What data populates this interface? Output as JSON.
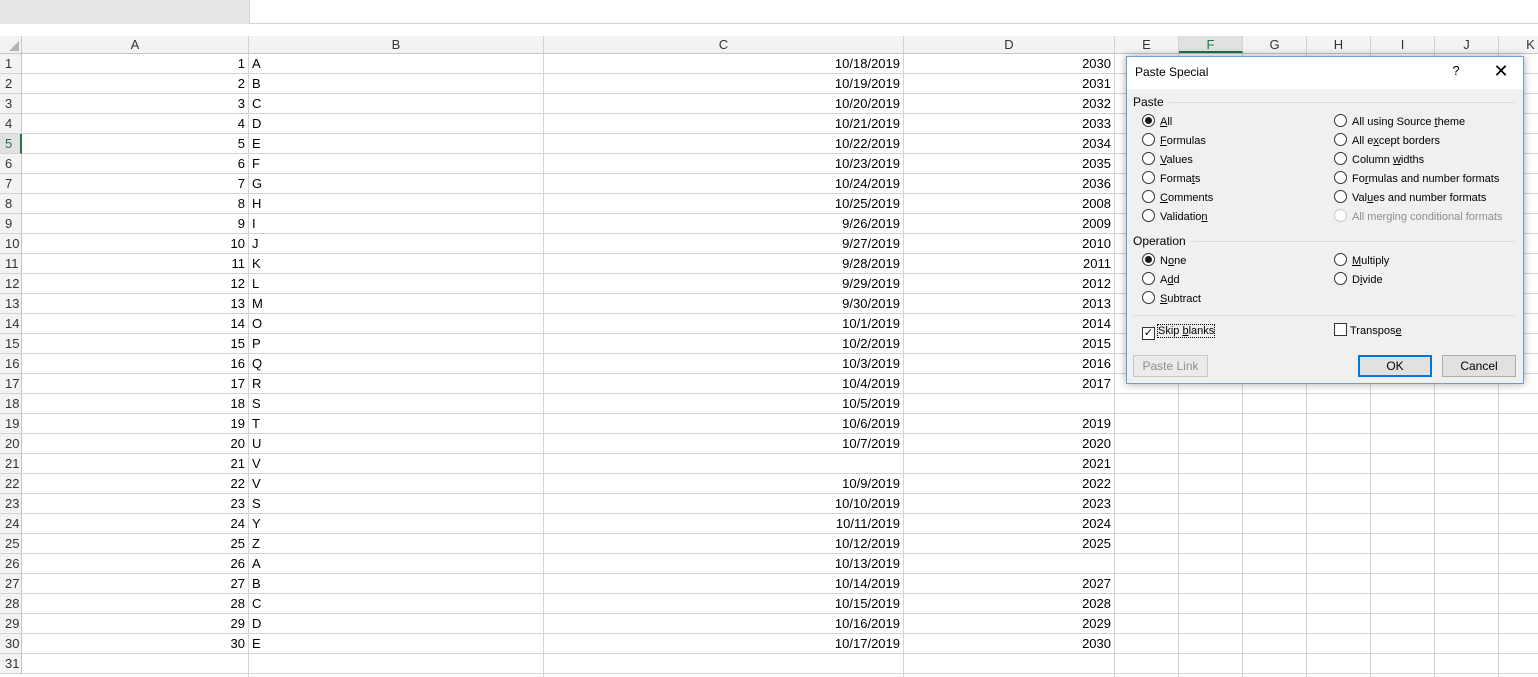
{
  "columns": [
    "A",
    "B",
    "C",
    "D",
    "E",
    "F",
    "G",
    "H",
    "I",
    "J",
    "K"
  ],
  "selected_column": "F",
  "selected_row": "5",
  "rows": [
    {
      "n": "1",
      "a": "1",
      "b": "A",
      "c": "10/18/2019",
      "d": "2030"
    },
    {
      "n": "2",
      "a": "2",
      "b": "B",
      "c": "10/19/2019",
      "d": "2031"
    },
    {
      "n": "3",
      "a": "3",
      "b": "C",
      "c": "10/20/2019",
      "d": "2032"
    },
    {
      "n": "4",
      "a": "4",
      "b": "D",
      "c": "10/21/2019",
      "d": "2033"
    },
    {
      "n": "5",
      "a": "5",
      "b": "E",
      "c": "10/22/2019",
      "d": "2034"
    },
    {
      "n": "6",
      "a": "6",
      "b": "F",
      "c": "10/23/2019",
      "d": "2035"
    },
    {
      "n": "7",
      "a": "7",
      "b": "G",
      "c": "10/24/2019",
      "d": "2036"
    },
    {
      "n": "8",
      "a": "8",
      "b": "H",
      "c": "10/25/2019",
      "d": "2008"
    },
    {
      "n": "9",
      "a": "9",
      "b": "I",
      "c": "9/26/2019",
      "d": "2009"
    },
    {
      "n": "10",
      "a": "10",
      "b": "J",
      "c": "9/27/2019",
      "d": "2010"
    },
    {
      "n": "11",
      "a": "11",
      "b": "K",
      "c": "9/28/2019",
      "d": "2011"
    },
    {
      "n": "12",
      "a": "12",
      "b": "L",
      "c": "9/29/2019",
      "d": "2012"
    },
    {
      "n": "13",
      "a": "13",
      "b": "M",
      "c": "9/30/2019",
      "d": "2013"
    },
    {
      "n": "14",
      "a": "14",
      "b": "O",
      "c": "10/1/2019",
      "d": "2014"
    },
    {
      "n": "15",
      "a": "15",
      "b": "P",
      "c": "10/2/2019",
      "d": "2015"
    },
    {
      "n": "16",
      "a": "16",
      "b": "Q",
      "c": "10/3/2019",
      "d": "2016"
    },
    {
      "n": "17",
      "a": "17",
      "b": "R",
      "c": "10/4/2019",
      "d": "2017"
    },
    {
      "n": "18",
      "a": "18",
      "b": "S",
      "c": "10/5/2019",
      "d": ""
    },
    {
      "n": "19",
      "a": "19",
      "b": "T",
      "c": "10/6/2019",
      "d": "2019"
    },
    {
      "n": "20",
      "a": "20",
      "b": "U",
      "c": "10/7/2019",
      "d": "2020"
    },
    {
      "n": "21",
      "a": "21",
      "b": "V",
      "c": "",
      "d": "2021"
    },
    {
      "n": "22",
      "a": "22",
      "b": "V",
      "c": "10/9/2019",
      "d": "2022"
    },
    {
      "n": "23",
      "a": "23",
      "b": "S",
      "c": "10/10/2019",
      "d": "2023"
    },
    {
      "n": "24",
      "a": "24",
      "b": "Y",
      "c": "10/11/2019",
      "d": "2024"
    },
    {
      "n": "25",
      "a": "25",
      "b": "Z",
      "c": "10/12/2019",
      "d": "2025"
    },
    {
      "n": "26",
      "a": "26",
      "b": "A",
      "c": "10/13/2019",
      "d": ""
    },
    {
      "n": "27",
      "a": "27",
      "b": "B",
      "c": "10/14/2019",
      "d": "2027"
    },
    {
      "n": "28",
      "a": "28",
      "b": "C",
      "c": "10/15/2019",
      "d": "2028"
    },
    {
      "n": "29",
      "a": "29",
      "b": "D",
      "c": "10/16/2019",
      "d": "2029"
    },
    {
      "n": "30",
      "a": "30",
      "b": "E",
      "c": "10/17/2019",
      "d": "2030"
    },
    {
      "n": "31",
      "a": "",
      "b": "",
      "c": "",
      "d": ""
    }
  ],
  "dialog": {
    "title": "Paste Special",
    "help": "?",
    "close": "✕",
    "paste_group": "Paste",
    "paste_options": [
      {
        "pre": "",
        "key": "A",
        "post": "ll",
        "checked": true,
        "disabled": false
      },
      {
        "pre": "",
        "key": "F",
        "post": "ormulas",
        "checked": false,
        "disabled": false
      },
      {
        "pre": "",
        "key": "V",
        "post": "alues",
        "checked": false,
        "disabled": false
      },
      {
        "pre": "Forma",
        "key": "t",
        "post": "s",
        "checked": false,
        "disabled": false
      },
      {
        "pre": "",
        "key": "C",
        "post": "omments",
        "checked": false,
        "disabled": false
      },
      {
        "pre": "Validatio",
        "key": "n",
        "post": "",
        "checked": false,
        "disabled": false
      },
      {
        "pre": "All using Source ",
        "key": "t",
        "post": "heme",
        "checked": false,
        "disabled": false
      },
      {
        "pre": "All e",
        "key": "x",
        "post": "cept borders",
        "checked": false,
        "disabled": false
      },
      {
        "pre": "Column ",
        "key": "w",
        "post": "idths",
        "checked": false,
        "disabled": false
      },
      {
        "pre": "Fo",
        "key": "r",
        "post": "mulas and number formats",
        "checked": false,
        "disabled": false
      },
      {
        "pre": "Val",
        "key": "u",
        "post": "es and number formats",
        "checked": false,
        "disabled": false
      },
      {
        "pre": "All merging conditional formats",
        "key": "",
        "post": "",
        "checked": false,
        "disabled": true
      }
    ],
    "operation_group": "Operation",
    "operation_options": [
      {
        "pre": "N",
        "key": "o",
        "post": "ne",
        "checked": true
      },
      {
        "pre": "A",
        "key": "d",
        "post": "d",
        "checked": false
      },
      {
        "pre": "",
        "key": "S",
        "post": "ubtract",
        "checked": false
      },
      {
        "pre": "",
        "key": "M",
        "post": "ultiply",
        "checked": false
      },
      {
        "pre": "D",
        "key": "i",
        "post": "vide",
        "checked": false
      }
    ],
    "skip_blanks": {
      "pre": "Skip ",
      "key": "b",
      "post": "lanks",
      "checked": true
    },
    "transpose": {
      "pre": "Transpos",
      "key": "e",
      "post": "",
      "checked": false
    },
    "paste_link": "Paste Link",
    "ok": "OK",
    "cancel": "Cancel"
  }
}
